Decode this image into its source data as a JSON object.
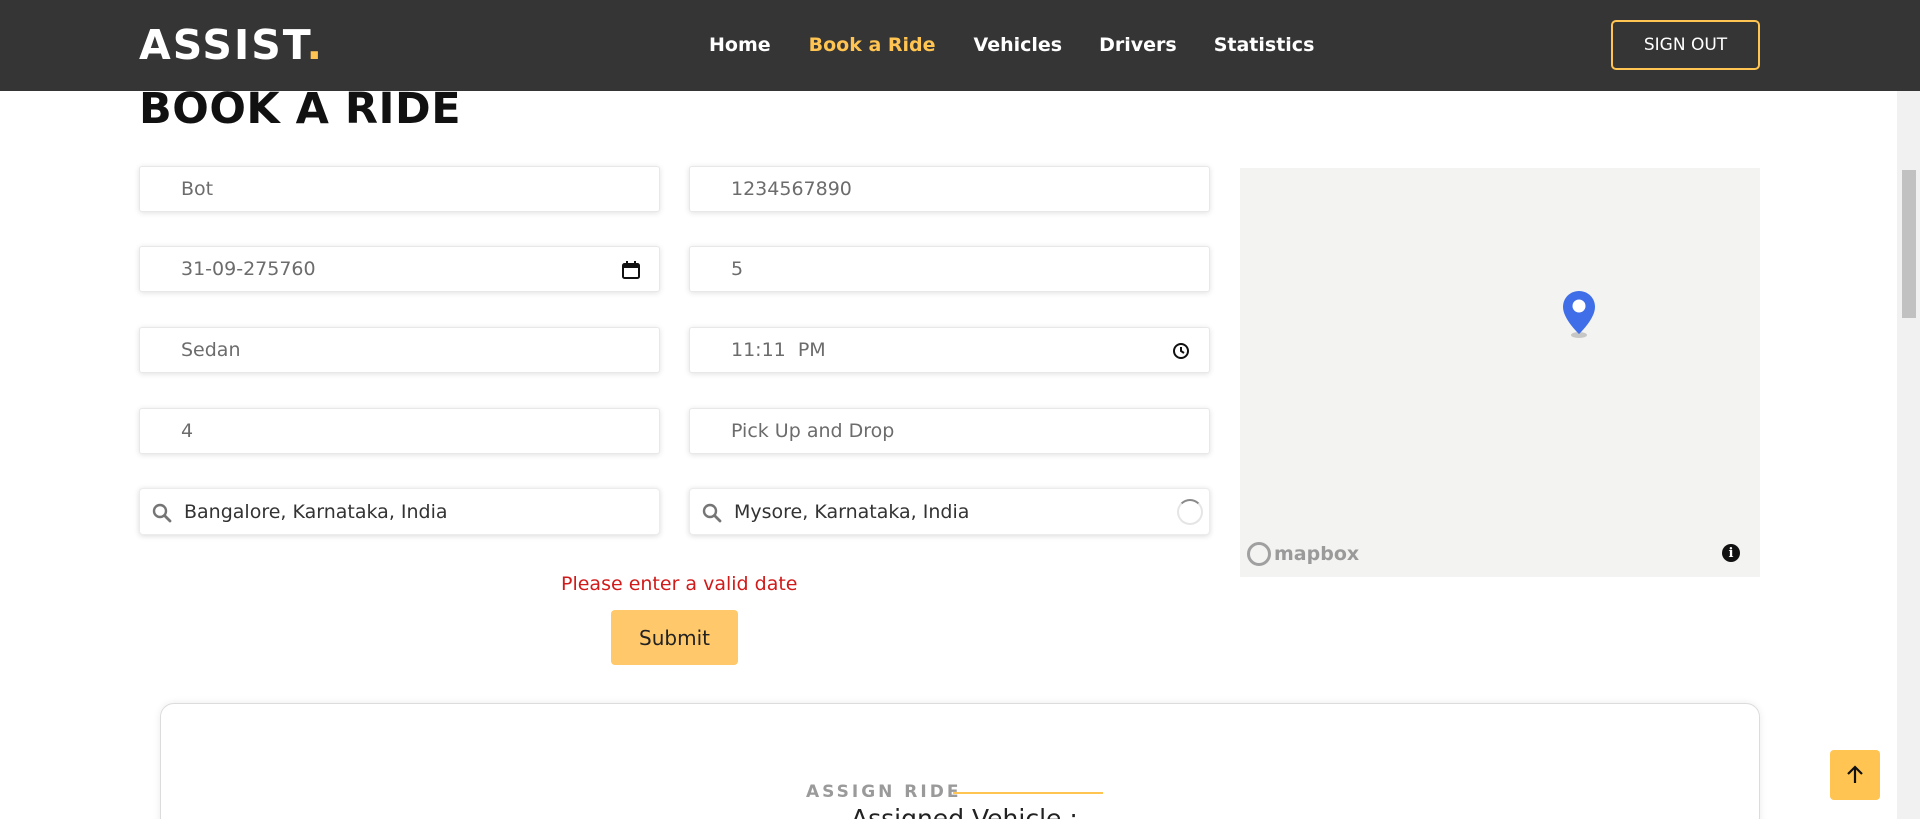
{
  "brand": {
    "name": "ASSIST",
    "dot": "."
  },
  "nav": {
    "items": [
      {
        "label": "Home",
        "active": false
      },
      {
        "label": "Book a Ride",
        "active": true
      },
      {
        "label": "Vehicles",
        "active": false
      },
      {
        "label": "Drivers",
        "active": false
      },
      {
        "label": "Statistics",
        "active": false
      }
    ],
    "signout_label": "SIGN OUT"
  },
  "page": {
    "title": "BOOK A RIDE"
  },
  "form": {
    "name": "Bot",
    "phone": "1234567890",
    "date": "31-09-275760",
    "passengers": "5",
    "vehicle_type": "Sedan",
    "time": "11:11  PM",
    "seats": "4",
    "service_type": "Pick Up and Drop",
    "pickup": "Bangalore, Karnataka, India",
    "drop": "Mysore, Karnataka, India",
    "error": "Please enter a valid date",
    "submit_label": "Submit"
  },
  "map": {
    "attribution_logo": "mapbox",
    "info_symbol": "i"
  },
  "assign": {
    "section_label": "ASSIGN RIDE",
    "assigned_vehicle_label": "Assigned Vehicle :"
  },
  "colors": {
    "navbar_bg": "#353535",
    "accent": "#ffc451",
    "submit_bg": "#ffc86a",
    "error": "#d11a1a",
    "pin": "#3f6ee8"
  },
  "icons": [
    "calendar-icon",
    "clock-icon",
    "search-icon",
    "map-pin-icon",
    "info-icon",
    "arrow-up-icon",
    "loading-spinner"
  ]
}
